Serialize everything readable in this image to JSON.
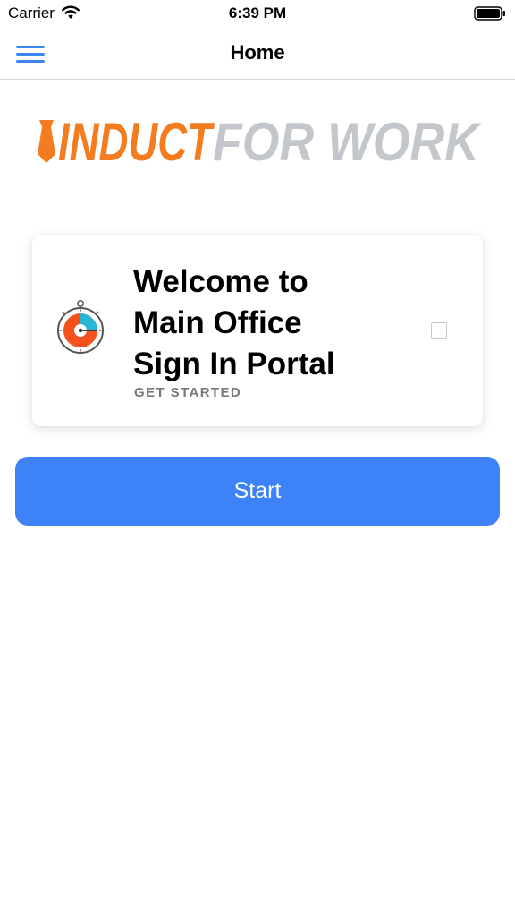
{
  "status_bar": {
    "carrier": "Carrier",
    "time": "6:39 PM"
  },
  "nav": {
    "title": "Home",
    "menu_icon": "hamburger-menu-icon"
  },
  "logo": {
    "part1": "INDUCT",
    "part2": "FOR WORK",
    "part1_color": "#f47c20",
    "part2_color": "#c3c7cc"
  },
  "card": {
    "title": "Welcome to\nMain Office\nSign In Portal",
    "subtitle": "GET STARTED",
    "icon": "stopwatch-icon",
    "checked": false
  },
  "start_button": {
    "label": "Start",
    "color": "#3d82f7"
  }
}
